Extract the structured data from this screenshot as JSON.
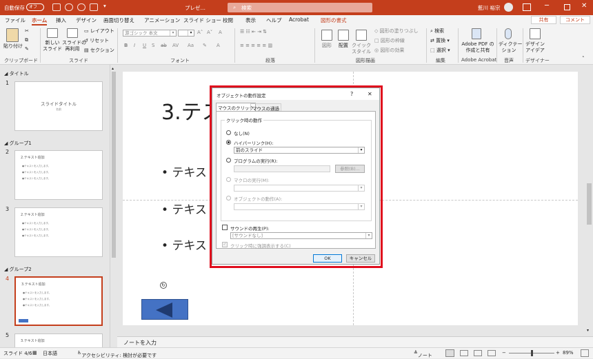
{
  "titlebar": {
    "autosave": "自動保存",
    "autosave_state": "オフ",
    "doc_title": "プレゼ…",
    "search_placeholder": "検索",
    "user": "藍川 裕宗",
    "account_initial": "NA"
  },
  "tabs": [
    "ファイル",
    "ホーム",
    "挿入",
    "デザイン",
    "画面切り替え",
    "アニメーション",
    "スライド ショー",
    "校閲",
    "表示",
    "ヘルプ",
    "Acrobat",
    "図形の書式"
  ],
  "share": {
    "share": "共有",
    "comment": "コメント"
  },
  "ribbon": {
    "clipboard": {
      "paste": "貼り付け",
      "label": "クリップボード"
    },
    "slides": {
      "new_slide": "新しい\nスライド",
      "reuse": "スライドの\n再利用",
      "layout": "レイアウト",
      "reset": "リセット",
      "section": "セクション",
      "label": "スライド"
    },
    "font": {
      "font_name": "游ゴシック 本文",
      "font_size": "",
      "label": "フォント",
      "b": "B",
      "i": "I",
      "u": "U",
      "s": "S",
      "ab": "ab",
      "av": "AV",
      "aa": "Aa",
      "a": "A"
    },
    "paragraph": {
      "label": "段落"
    },
    "drawing": {
      "shapes": "図形",
      "arrange": "配置",
      "quick_styles": "クイック\nスタイル",
      "fill": "図形の塗りつぶし",
      "outline": "図形の枠線",
      "effects": "図形の効果",
      "label": "図形描画"
    },
    "editing": {
      "find": "検索",
      "replace": "置換",
      "select": "選択",
      "label": "編集"
    },
    "acrobat": {
      "create": "Adobe PDF の\n作成と共有",
      "label": "Adobe Acrobat"
    },
    "voice": {
      "dictate": "ディクテー\nション",
      "label": "音声"
    },
    "designer": {
      "ideas": "デザイン\nアイデア",
      "label": "デザイナー"
    }
  },
  "thumbnails": {
    "sections": [
      "タイトル",
      "グループ1",
      "グループ2"
    ],
    "slides": [
      {
        "num": "1",
        "title": "スライドタイトル",
        "sub": "名前"
      },
      {
        "num": "2",
        "title": "2.テキスト追加",
        "lines": [
          "●テキストを入力します。",
          "●テキストを入力します。",
          "●テキストを入力します。"
        ]
      },
      {
        "num": "3",
        "title": "2.テキスト追加",
        "lines": [
          "●テキストを入力します。",
          "●テキストを入力します。",
          "●テキストを入力します。"
        ]
      },
      {
        "num": "4",
        "title": "3.テキスト追加",
        "lines": [
          "●テキストを入力します。",
          "●テキストを入力します。",
          "●テキストを入力します。"
        ]
      },
      {
        "num": "5",
        "title": "3.テキスト追加"
      }
    ]
  },
  "slide": {
    "title": "3.テス",
    "bullets": [
      "テキス",
      "テキス",
      "テキス"
    ]
  },
  "dialog": {
    "title": "オブジェクトの動作設定",
    "help": "?",
    "close": "✕",
    "tabs": [
      "マウスのクリック",
      "マウスの通過"
    ],
    "group_label": "クリック時の動作",
    "opt_none": "なし(N)",
    "opt_hyperlink": "ハイパーリンク(H):",
    "hyperlink_value": "前のスライド",
    "opt_program": "プログラムの実行(R):",
    "browse": "参照(B)...",
    "opt_macro": "マクロの実行(M):",
    "opt_object": "オブジェクトの動作(A):",
    "sound_label": "サウンドの再生(P):",
    "sound_value": "[サウンドなし]",
    "highlight_label": "クリック時に強調表示する(C)",
    "ok": "OK",
    "cancel": "キャンセル"
  },
  "notes_placeholder": "ノートを入力",
  "status": {
    "slide": "スライド 4/6",
    "lang": "日本語",
    "accessibility": "アクセシビリティ: 検討が必要です",
    "notes": "ノート",
    "zoom": "89%"
  },
  "colors": {
    "accent": "#c43e1c",
    "selection": "#4472c4",
    "highlight_box": "#e00d1d"
  }
}
